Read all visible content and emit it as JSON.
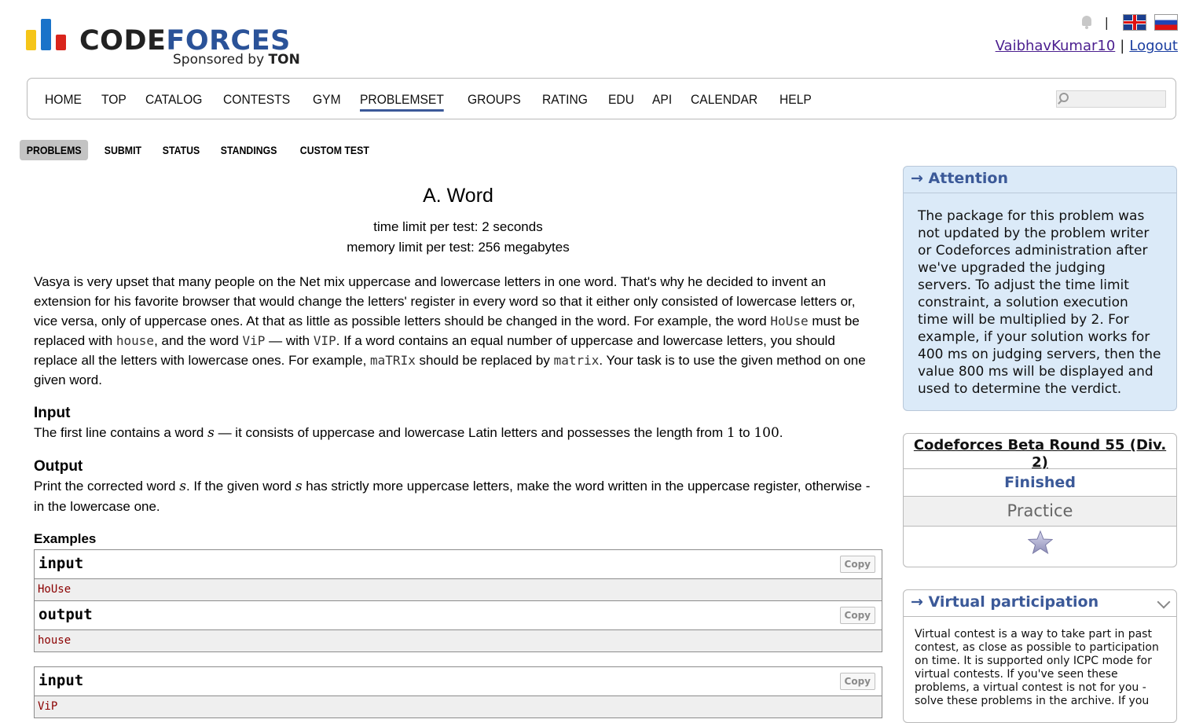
{
  "header": {
    "logo_word_a": "CODE",
    "logo_word_b": "FORCES",
    "sponsor_text": "Sponsored by",
    "sponsor_brand": "TON",
    "username": "VaibhavKumar10",
    "separator": "|",
    "logout": "Logout"
  },
  "colors": {
    "brand_blue": "#2a5298",
    "accent": "#3b5998",
    "attention_bg": "#dbeaf8",
    "sample_text": "#8b0000"
  },
  "menu": [
    "HOME",
    "TOP",
    "CATALOG",
    "CONTESTS",
    "GYM",
    "PROBLEMSET",
    "GROUPS",
    "RATING",
    "EDU",
    "API",
    "CALENDAR",
    "HELP"
  ],
  "menu_active": "PROBLEMSET",
  "submenu": [
    "PROBLEMS",
    "SUBMIT",
    "STATUS",
    "STANDINGS",
    "CUSTOM TEST"
  ],
  "problem": {
    "title": "A. Word",
    "time_limit": "time limit per test: 2 seconds",
    "memory_limit": "memory limit per test: 256 megabytes",
    "legend": {
      "t1": "Vasya is very upset that many people on the Net mix uppercase and lowercase letters in one word. That's why he decided to invent an extension for his favorite browser that would change the letters' register in every word so that it either only consisted of lowercase letters or, vice versa, only of uppercase ones. At that as little as possible letters should be changed in the word. For example, the word ",
      "w1": "HoUse",
      "t2": " must be replaced with ",
      "w2": "house",
      "t3": ", and the word ",
      "w3": "ViP",
      "t4": " — with ",
      "w4": "VIP",
      "t5": ". If a word contains an equal number of uppercase and lowercase letters, you should replace all the letters with lowercase ones. For example, ",
      "w5": "maTRIx",
      "t6": " should be replaced by ",
      "w6": "matrix",
      "t7": ". Your task is to use the given method on one given word."
    },
    "input_title": "Input",
    "input": {
      "t1": "The first line contains a word ",
      "s": "s",
      "t2": " — it consists of uppercase and lowercase Latin letters and possesses the length from ",
      "n1": "1",
      "t3": " to ",
      "n2": "100",
      "t4": "."
    },
    "output_title": "Output",
    "output": {
      "t1": "Print the corrected word ",
      "s1": "s",
      "t2": ". If the given word ",
      "s2": "s",
      "t3": " has strictly more uppercase letters, make the word written in the uppercase register, otherwise - in the lowercase one."
    },
    "examples_title": "Examples",
    "samples": [
      {
        "label": "input",
        "copy": "Copy",
        "value": "HoUse"
      },
      {
        "label": "output",
        "copy": "Copy",
        "value": "house"
      },
      {
        "label": "input",
        "copy": "Copy",
        "value": "ViP"
      }
    ]
  },
  "sidebar": {
    "attention": {
      "arrow": "→",
      "title": "Attention",
      "text": "The package for this problem was not updated by the problem writer or Codeforces administration after we've upgraded the judging servers. To adjust the time limit constraint, a solution execution time will be multiplied by 2. For example, if your solution works for 400 ms on judging servers, then the value 800 ms will be displayed and used to determine the verdict."
    },
    "contest": {
      "name": "Codeforces Beta Round 55 (Div. 2)",
      "status": "Finished",
      "phase": "Practice",
      "star_icon": "star-icon"
    },
    "virtual": {
      "arrow": "→",
      "title": "Virtual participation",
      "text": "Virtual contest is a way to take part in past contest, as close as possible to participation on time. It is supported only ICPC mode for virtual contests. If you've seen these problems, a virtual contest is not for you - solve these problems in the archive. If you"
    }
  }
}
